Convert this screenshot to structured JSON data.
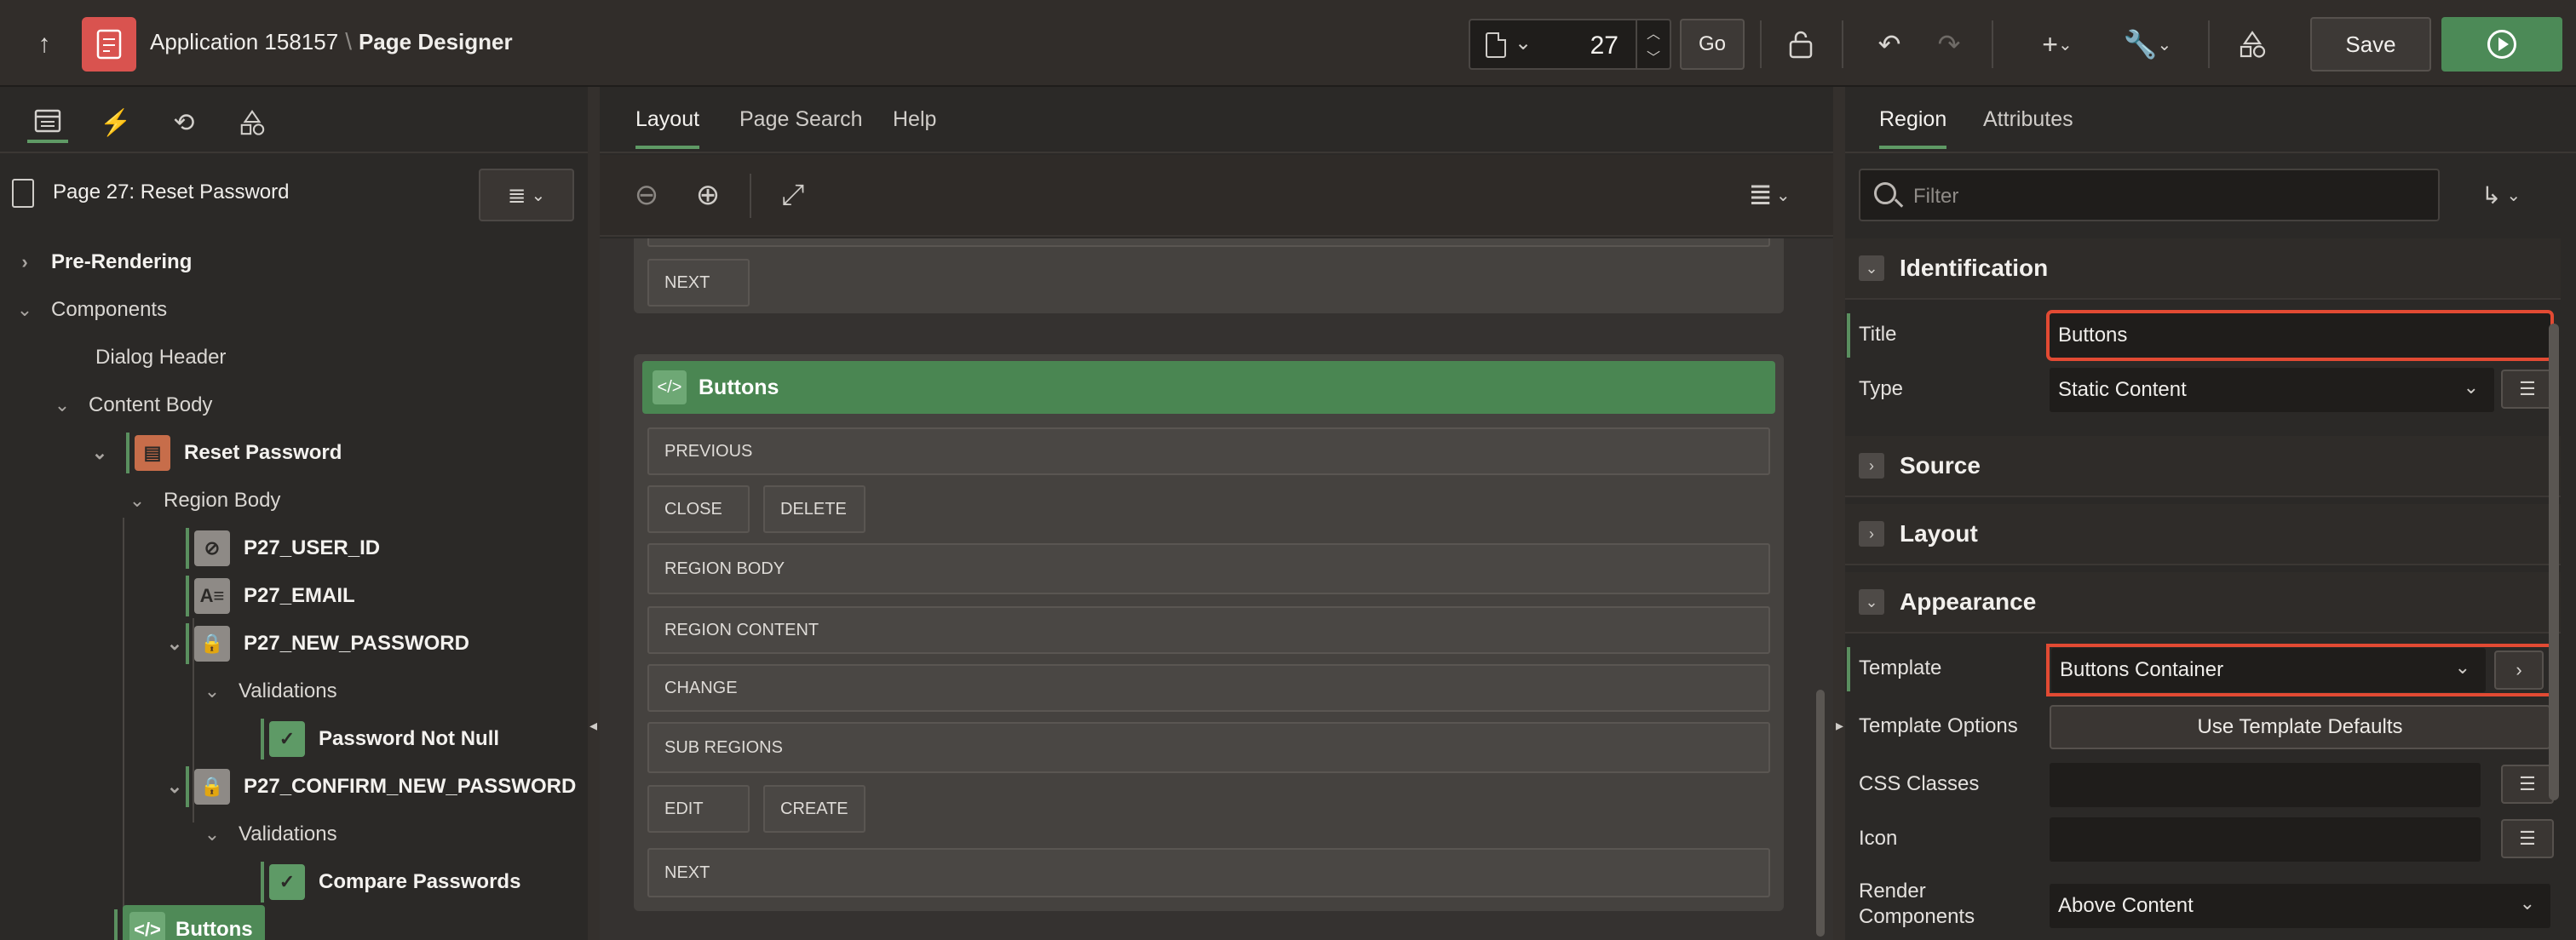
{
  "topbar": {
    "app_name": "Application 158157",
    "separator": "\\",
    "page_designer": "Page Designer",
    "page_number": "27",
    "go_label": "Go",
    "save_label": "Save"
  },
  "left": {
    "page_title": "Page 27: Reset Password",
    "tree": {
      "pre_rendering": "Pre-Rendering",
      "components": "Components",
      "dialog_header": "Dialog Header",
      "content_body": "Content Body",
      "reset_password": "Reset Password",
      "region_body": "Region Body",
      "p27_user_id": "P27_USER_ID",
      "p27_email": "P27_EMAIL",
      "p27_new_password": "P27_NEW_PASSWORD",
      "validations_1": "Validations",
      "password_not_null": "Password Not Null",
      "p27_confirm_new_password": "P27_CONFIRM_NEW_PASSWORD",
      "validations_2": "Validations",
      "compare_passwords": "Compare Passwords",
      "buttons": "Buttons"
    }
  },
  "middle": {
    "tabs": [
      "Layout",
      "Page Search",
      "Help"
    ],
    "top_region_next": "NEXT",
    "region_title": "Buttons",
    "positions": {
      "previous": "PREVIOUS",
      "close": "CLOSE",
      "delete": "DELETE",
      "region_body": "REGION BODY",
      "region_content": "REGION CONTENT",
      "change": "CHANGE",
      "sub_regions": "SUB REGIONS",
      "edit": "EDIT",
      "create": "CREATE",
      "next": "NEXT"
    }
  },
  "right": {
    "tabs": [
      "Region",
      "Attributes"
    ],
    "filter_placeholder": "Filter",
    "sections": {
      "identification": "Identification",
      "source": "Source",
      "layout": "Layout",
      "appearance": "Appearance"
    },
    "props": {
      "title_label": "Title",
      "title_value": "Buttons",
      "type_label": "Type",
      "type_value": "Static Content",
      "template_label": "Template",
      "template_value": "Buttons Container",
      "template_options_label": "Template Options",
      "template_options_value": "Use Template Defaults",
      "css_classes_label": "CSS Classes",
      "icon_label": "Icon",
      "render_components_label": "Render Components",
      "render_components_value": "Above Content"
    }
  },
  "colors": {
    "accent_green": "#4c8a57",
    "highlight_red": "#e24a33",
    "region_orange": "#c76d4a"
  }
}
